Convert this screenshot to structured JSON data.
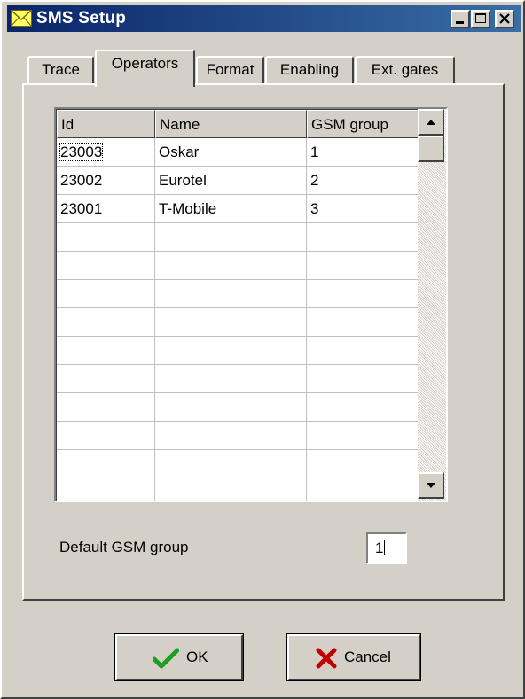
{
  "window": {
    "title": "SMS Setup"
  },
  "titlebar_buttons": [
    "minimize",
    "maximize",
    "close"
  ],
  "tabs": [
    {
      "label": "Trace",
      "active": false
    },
    {
      "label": "Operators",
      "active": true
    },
    {
      "label": "Format",
      "active": false
    },
    {
      "label": "Enabling",
      "active": false
    },
    {
      "label": "Ext. gates",
      "active": false
    }
  ],
  "grid": {
    "columns": [
      "Id",
      "Name",
      "GSM group"
    ],
    "rows": [
      [
        "23003",
        "Oskar",
        "1"
      ],
      [
        "23002",
        "Eurotel",
        "2"
      ],
      [
        "23001",
        "T-Mobile",
        "3"
      ]
    ]
  },
  "default_group": {
    "label": "Default GSM group",
    "value": "1"
  },
  "buttons": {
    "ok": "OK",
    "cancel": "Cancel"
  },
  "colors": {
    "titlebar": "#0a246a",
    "face": "#d4d0c8",
    "ok_check": "#1f9e1f",
    "cancel_x": "#c00000"
  },
  "icons": {
    "title": "envelope-icon",
    "ok": "checkmark-icon",
    "cancel": "x-icon"
  }
}
